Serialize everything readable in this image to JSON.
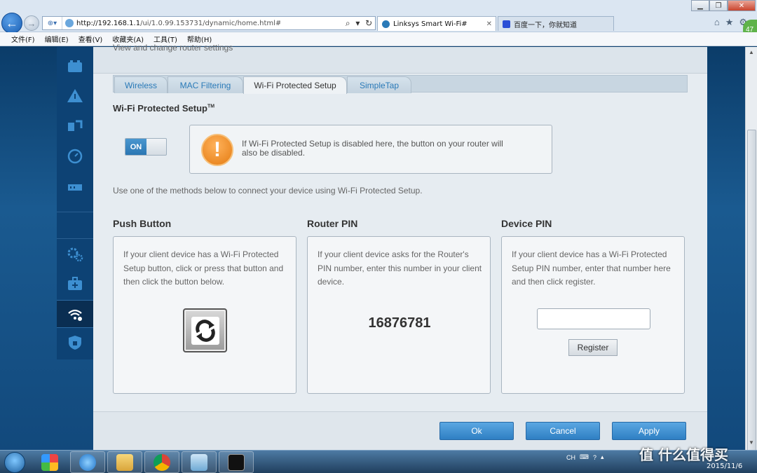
{
  "browser": {
    "url_host": "http://192.168.1.1",
    "url_path": "/ui/1.0.99.153731/dynamic/home.html#",
    "tabs": [
      {
        "label": "Linksys Smart Wi-Fi#",
        "icon": "linksys-icon"
      },
      {
        "label": "百度一下，你就知道",
        "icon": "baidu-paw-icon"
      }
    ],
    "menu": [
      "文件(F)",
      "编辑(E)",
      "查看(V)",
      "收藏夹(A)",
      "工具(T)",
      "帮助(H)"
    ],
    "badge": "47"
  },
  "page": {
    "subtitle": "View and change router settings",
    "tabs": [
      "Wireless",
      "MAC Filtering",
      "Wi-Fi Protected Setup",
      "SimpleTap"
    ],
    "active_tab": "Wi-Fi Protected Setup",
    "section_title": "Wi-Fi Protected Setup",
    "section_title_mark": "TM",
    "toggle_label": "ON",
    "warning_text": "If Wi-Fi Protected Setup is disabled here, the button on your router will also be disabled.",
    "intro_text": "Use one of the methods below to connect your device using Wi-Fi Protected Setup.",
    "push_button": {
      "title": "Push Button",
      "description": "If your client device has a Wi-Fi Protected Setup button, click or press that button and then click the button below."
    },
    "router_pin": {
      "title": "Router PIN",
      "description": "If your client device asks for the Router's PIN number, enter this number in your client device.",
      "pin": "16876781"
    },
    "device_pin": {
      "title": "Device PIN",
      "description": "If your client device has a Wi-Fi Protected Setup PIN number, enter that number here and then click register.",
      "input_value": "",
      "register_label": "Register"
    },
    "buttons": {
      "ok": "Ok",
      "cancel": "Cancel",
      "apply": "Apply"
    }
  },
  "taskbar": {
    "tray_lang": "CH",
    "date": "2015/11/6"
  },
  "watermark": "值 什么值得买",
  "colors": {
    "accent": "#2f7fc3",
    "nav": "#0d4274",
    "warning": "#e47b12",
    "link": "#2a7ab8"
  }
}
